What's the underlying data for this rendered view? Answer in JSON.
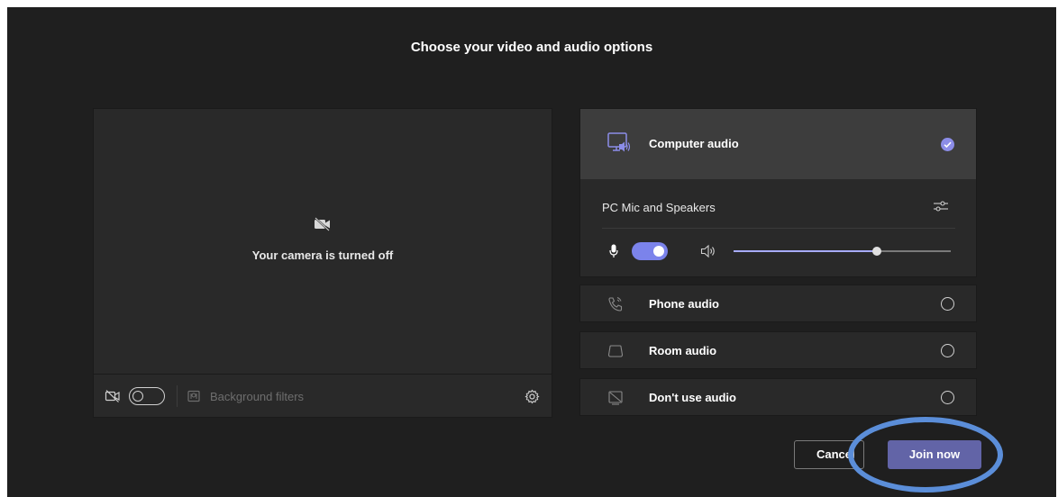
{
  "dialog": {
    "title": "Choose your video and audio options"
  },
  "video": {
    "camera_off_text": "Your camera is turned off",
    "camera_toggle_on": false,
    "background_filters_label": "Background filters",
    "icons": [
      "camera-off-icon",
      "background-filters-icon",
      "settings-gear-icon"
    ]
  },
  "audio": {
    "computer_audio": {
      "label": "Computer audio",
      "selected": true,
      "device_label": "PC Mic and Speakers",
      "mic_on": true,
      "volume_level": 0.66
    },
    "options": [
      {
        "label": "Phone audio",
        "icon": "phone-icon",
        "selected": false
      },
      {
        "label": "Room audio",
        "icon": "room-icon",
        "selected": false
      },
      {
        "label": "Don't use audio",
        "icon": "no-audio-icon",
        "selected": false
      }
    ]
  },
  "buttons": {
    "cancel_label": "Cancel",
    "join_label": "Join now"
  },
  "colors": {
    "accent": "#6264a7",
    "accent_light": "#7b83eb",
    "annotation_ring": "#5b8ed9",
    "background": "#1f1f1f"
  }
}
